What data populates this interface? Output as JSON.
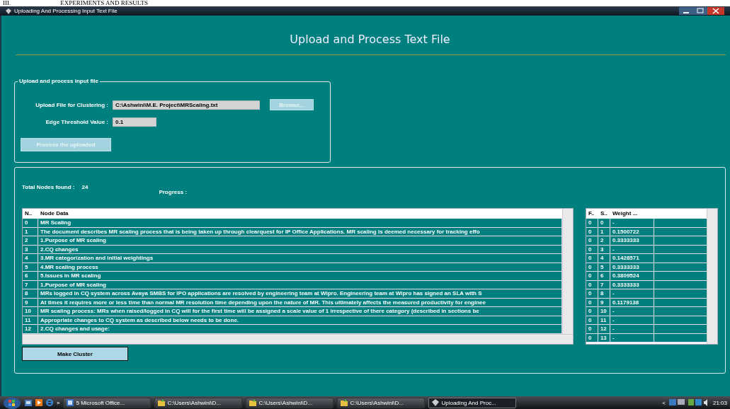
{
  "document_heading": {
    "number": "III.",
    "title": "EXPERIMENTS AND RESULTS"
  },
  "window": {
    "title": "Uploading And Processing Input Text File"
  },
  "header": "Upload and Process Text File",
  "upload_group": {
    "legend": "Upload and process input file",
    "file_label": "Upload File for Clustering :",
    "file_value": "C:\\Ashwini\\M.E. Project\\MRScaling.txt",
    "browse_button": {
      "label": "Browse...",
      "disabled": true
    },
    "threshold_label": "Edge Threshold Value :",
    "threshold_value": "0.1",
    "process_button": {
      "label": "Process the uploaded",
      "disabled": true
    }
  },
  "results": {
    "total_label": "Total Nodes found :",
    "total_value": "24",
    "progress_label": "Progress :",
    "node_table": {
      "columns": [
        "N..",
        "Node Data"
      ],
      "rows": [
        [
          "0",
          "MR Scaling"
        ],
        [
          "1",
          "The document describes MR scaling process that is being taken up through clearquest for IP Office Applications. MR scaling is deemed necessary for tracking effo"
        ],
        [
          "2",
          "1.Purpose of MR scaling"
        ],
        [
          "3",
          "2.CQ changes"
        ],
        [
          "4",
          "3.MR categorization and initial weightings"
        ],
        [
          "5",
          "4.MR scaling process"
        ],
        [
          "6",
          "5.Issues in MR scaling"
        ],
        [
          "7",
          "1.Purpose of MR scaling"
        ],
        [
          "8",
          "MRs logged in CQ system across Avaya SMBS for IPO applications are resolved by engineering team at Wipro. Engineering team at Wipro has signed an SLA with S"
        ],
        [
          "9",
          "At times it requires more or less time than normal MR resolution time depending upon the nature of MR. This ultimately affects the measured productivity for enginee"
        ],
        [
          "10",
          "MR scaling process: MRs when raised/logged in CQ will for the first time will be assigned a scale value of 1 irrespective of there category (described in sections be"
        ],
        [
          "11",
          "Appropriate changes to CQ system as described below needs to be done."
        ],
        [
          "12",
          "2.CQ changes and usage:"
        ]
      ]
    },
    "weight_table": {
      "columns": [
        "F..",
        "S..",
        "Weight ..."
      ],
      "rows": [
        [
          "0",
          "0",
          "-"
        ],
        [
          "0",
          "1",
          "0.1500722"
        ],
        [
          "0",
          "2",
          "0.3333333"
        ],
        [
          "0",
          "3",
          "-"
        ],
        [
          "0",
          "4",
          "0.1428571"
        ],
        [
          "0",
          "5",
          "0.3333333"
        ],
        [
          "0",
          "6",
          "0.3809524"
        ],
        [
          "0",
          "7",
          "0.3333333"
        ],
        [
          "0",
          "8",
          "-"
        ],
        [
          "0",
          "9",
          "0.1179138"
        ],
        [
          "0",
          "10",
          "-"
        ],
        [
          "0",
          "11",
          "-"
        ],
        [
          "0",
          "12",
          "-"
        ],
        [
          "0",
          "13",
          "-"
        ]
      ]
    },
    "make_cluster_button": {
      "label": "Make Cluster",
      "disabled": false
    }
  },
  "taskbar": {
    "overflow": "»",
    "items": [
      {
        "label": "5 Microsoft Office...",
        "kind": "office",
        "selected": false
      },
      {
        "label": "C:\\Users\\Ashwini\\D...",
        "kind": "folder",
        "selected": false
      },
      {
        "label": "C:\\Users\\Ashwini\\D...",
        "kind": "folder",
        "selected": false
      },
      {
        "label": "C:\\Users\\Ashwini\\D...",
        "kind": "folder",
        "selected": false
      },
      {
        "label": "Uploading And Proc...",
        "kind": "app",
        "selected": true
      }
    ],
    "tray_arrow": "<",
    "clock": "21:03"
  }
}
